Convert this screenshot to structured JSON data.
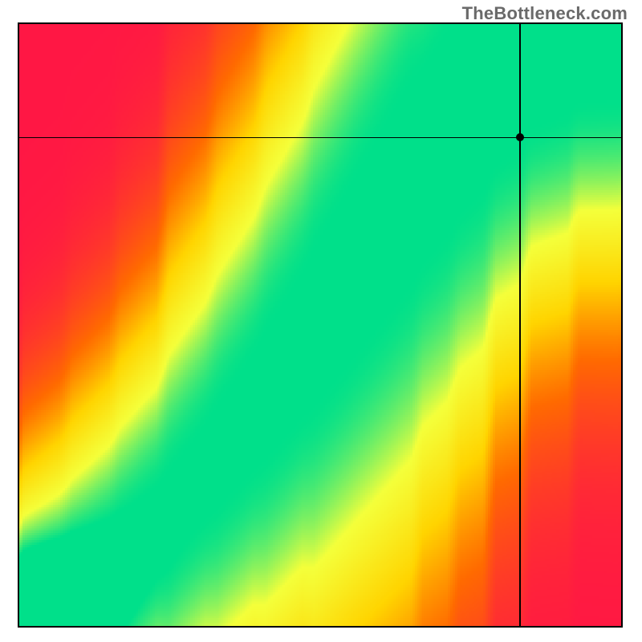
{
  "watermark": "TheBottleneck.com",
  "chart_data": {
    "type": "heatmap",
    "title": "",
    "xlabel": "",
    "ylabel": "",
    "xlim": [
      0,
      1
    ],
    "ylim": [
      0,
      1
    ],
    "grid": false,
    "crosshair": {
      "x": 0.83,
      "y": 0.81
    },
    "marker": {
      "x": 0.83,
      "y": 0.81
    },
    "colormap": {
      "stops": [
        {
          "t": 0.0,
          "color": "#ff1744"
        },
        {
          "t": 0.3,
          "color": "#ff6a00"
        },
        {
          "t": 0.55,
          "color": "#ffd400"
        },
        {
          "t": 0.8,
          "color": "#f4ff3a"
        },
        {
          "t": 1.0,
          "color": "#00e08a"
        }
      ]
    },
    "ridge": {
      "description": "Green optimal band center as y(x), normalized 0..1; plot is y-up.",
      "points": [
        {
          "x": 0.0,
          "y": 0.0
        },
        {
          "x": 0.08,
          "y": 0.05
        },
        {
          "x": 0.16,
          "y": 0.11
        },
        {
          "x": 0.24,
          "y": 0.18
        },
        {
          "x": 0.32,
          "y": 0.27
        },
        {
          "x": 0.4,
          "y": 0.37
        },
        {
          "x": 0.48,
          "y": 0.48
        },
        {
          "x": 0.54,
          "y": 0.57
        },
        {
          "x": 0.6,
          "y": 0.66
        },
        {
          "x": 0.66,
          "y": 0.75
        },
        {
          "x": 0.72,
          "y": 0.83
        },
        {
          "x": 0.78,
          "y": 0.9
        },
        {
          "x": 0.84,
          "y": 0.95
        },
        {
          "x": 0.92,
          "y": 0.99
        },
        {
          "x": 1.0,
          "y": 1.0
        }
      ],
      "width_start": 0.015,
      "width_end": 0.12
    }
  }
}
